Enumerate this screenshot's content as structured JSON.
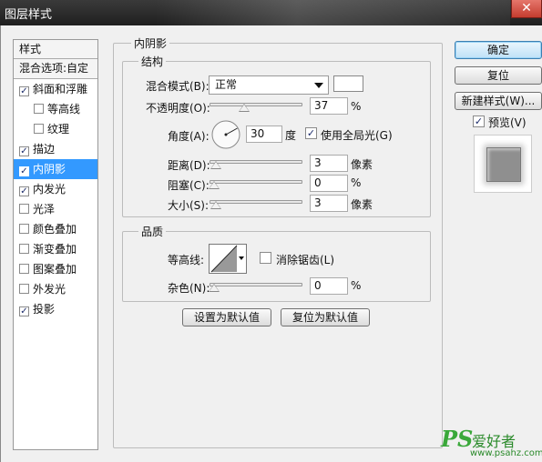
{
  "window": {
    "title": "图层样式",
    "close_label": "✕"
  },
  "style_list": {
    "header": "样式",
    "blend_options": "混合选项:自定",
    "items": [
      {
        "label": "斜面和浮雕",
        "checked": true,
        "sub": false
      },
      {
        "label": "等高线",
        "checked": false,
        "sub": true
      },
      {
        "label": "纹理",
        "checked": false,
        "sub": true
      },
      {
        "label": "描边",
        "checked": true,
        "sub": false
      },
      {
        "label": "内阴影",
        "checked": true,
        "sub": false,
        "selected": true
      },
      {
        "label": "内发光",
        "checked": true,
        "sub": false
      },
      {
        "label": "光泽",
        "checked": false,
        "sub": false
      },
      {
        "label": "颜色叠加",
        "checked": false,
        "sub": false
      },
      {
        "label": "渐变叠加",
        "checked": false,
        "sub": false
      },
      {
        "label": "图案叠加",
        "checked": false,
        "sub": false
      },
      {
        "label": "外发光",
        "checked": false,
        "sub": false
      },
      {
        "label": "投影",
        "checked": true,
        "sub": false
      }
    ]
  },
  "inner_shadow": {
    "title": "内阴影",
    "structure": {
      "title": "结构",
      "blend_mode_label": "混合模式(B):",
      "blend_mode_value": "正常",
      "color": "#ffffff",
      "opacity_label": "不透明度(O):",
      "opacity_value": "37",
      "opacity_unit": "%",
      "opacity_fraction": 0.37,
      "angle_label": "角度(A):",
      "angle_value": "30",
      "angle_unit": "度",
      "global_light_label": "使用全局光(G)",
      "global_light_checked": true,
      "distance_label": "距离(D):",
      "distance_value": "3",
      "distance_unit": "像素",
      "choke_label": "阻塞(C):",
      "choke_value": "0",
      "choke_unit": "%",
      "size_label": "大小(S):",
      "size_value": "3",
      "size_unit": "像素"
    },
    "quality": {
      "title": "品质",
      "contour_label": "等高线:",
      "antialias_label": "消除锯齿(L)",
      "antialias_checked": false,
      "noise_label": "杂色(N):",
      "noise_value": "0",
      "noise_unit": "%"
    },
    "set_default_label": "设置为默认值",
    "reset_default_label": "复位为默认值"
  },
  "buttons": {
    "ok": "确定",
    "reset": "复位",
    "new_style": "新建样式(W)...",
    "preview_label": "预览(V)",
    "preview_checked": true
  },
  "watermark": {
    "ps": "PS",
    "cn": "爱好者",
    "url": "www.psahz.com"
  }
}
